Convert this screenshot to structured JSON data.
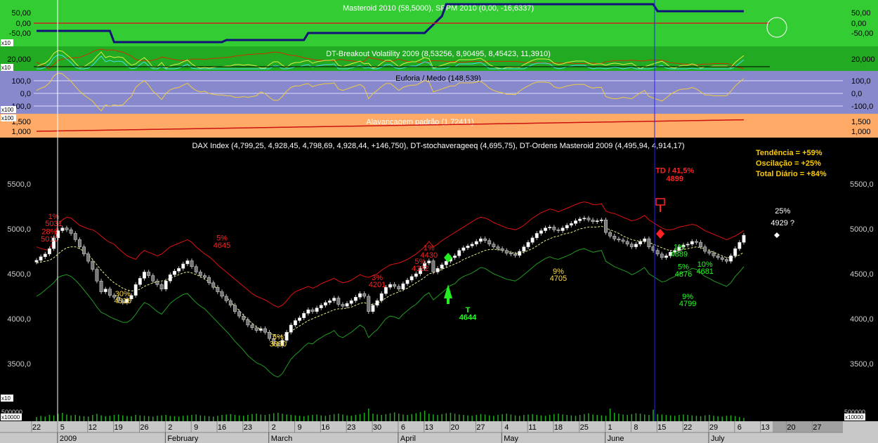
{
  "panels": {
    "masteroid": {
      "title": "Masteroid 2010 (58,5000), SPPM 2010 (0,00, -16,6337)",
      "ticks_left": [
        "50,00",
        "0,00",
        "-50,00"
      ],
      "ticks_right": [
        "50,00",
        "0,00",
        "-50,00"
      ],
      "scale_tag": "x10",
      "bg": "#33cc33"
    },
    "breakout": {
      "title": "DT-Breakout Volatility 2009 (8,53256, 8,90495, 8,45423, 11,3910)",
      "ticks_left": [
        "20,000"
      ],
      "ticks_right": [
        "20,000"
      ],
      "scale_tag": "x10",
      "bg": "#22aa22"
    },
    "euforia": {
      "title": "Euforia / Medo (148,539)",
      "ticks_left": [
        "100,0",
        "0,0",
        "-100,0"
      ],
      "ticks_right": [
        "100,0",
        "0,0",
        "-100,0"
      ],
      "scale_tag": "x100",
      "bg": "#8888cc"
    },
    "alavancagem": {
      "title": "Alavancagem padrão (1,72411)",
      "ticks_left": [
        "1,500",
        "1,000"
      ],
      "ticks_right": [
        "1,500",
        "1,000"
      ],
      "scale_tag": "x100",
      "bg": "#ffaa66"
    },
    "price": {
      "title": "DAX Index (4,799,25, 4,928,45, 4,798,69, 4,928,44, +146,750), DT-stochaverageeq (4,695,75), DT-Ordens Masteroid 2009 (4,495,94, 4,914,17)",
      "ticks_left": [
        "5500,0",
        "5000,0",
        "4500,0",
        "4000,0",
        "3500,0"
      ],
      "ticks_right": [
        "5500,0",
        "5000,0",
        "4500,0",
        "4000,0",
        "3500,0"
      ],
      "scale_tag": "x10",
      "volume_label": "500000",
      "volume_tag": "x10000"
    }
  },
  "summary": {
    "tendencia": "Tendência = +59%",
    "oscilacao": "Oscilação = +25%",
    "total": "Total Diário = +84%"
  },
  "annotations": [
    {
      "text": "1%",
      "color": "#ff2222",
      "i": 4,
      "p": 5110
    },
    {
      "text": "5031",
      "color": "#ff2222",
      "i": 4,
      "p": 5030
    },
    {
      "text": "28%",
      "color": "#ff2222",
      "i": 3,
      "p": 4940
    },
    {
      "text": "5010",
      "color": "#ff2222",
      "i": 3,
      "p": 4860
    },
    {
      "text": "5%",
      "color": "#ff2222",
      "i": 43,
      "p": 4870
    },
    {
      "text": "4645",
      "color": "#ff2222",
      "i": 43,
      "p": 4790
    },
    {
      "text": "30%",
      "color": "#ffdd44",
      "i": 20,
      "p": 4250
    },
    {
      "text": "4318",
      "color": "#ffdd44",
      "i": 20,
      "p": 4170
    },
    {
      "text": "5%",
      "color": "#ffdd44",
      "i": 56,
      "p": 3770
    },
    {
      "text": "3850",
      "color": "#ffdd44",
      "i": 56,
      "p": 3690
    },
    {
      "text": "3%",
      "color": "#ff2222",
      "i": 79,
      "p": 4430
    },
    {
      "text": "4201",
      "color": "#ff2222",
      "i": 79,
      "p": 4350
    },
    {
      "text": "5%",
      "color": "#ff2222",
      "i": 89,
      "p": 4610
    },
    {
      "text": "4382",
      "color": "#ff2222",
      "i": 89,
      "p": 4530
    },
    {
      "text": "1%",
      "color": "#ff2222",
      "i": 91,
      "p": 4760
    },
    {
      "text": "4430",
      "color": "#ff2222",
      "i": 91,
      "p": 4680
    },
    {
      "text": "T",
      "color": "#22ff22",
      "i": 100,
      "p": 4070
    },
    {
      "text": "4644",
      "color": "#22ff22",
      "i": 100,
      "p": 3990
    },
    {
      "text": "9%",
      "color": "#ffdd44",
      "i": 121,
      "p": 4500
    },
    {
      "text": "4705",
      "color": "#ffdd44",
      "i": 121,
      "p": 4420
    },
    {
      "text": "TD / 41,5%",
      "color": "#ff2222",
      "i": 148,
      "p": 5620
    },
    {
      "text": "4899",
      "color": "#ff2222",
      "i": 148,
      "p": 5530
    },
    {
      "text": "1%",
      "color": "#22ff22",
      "i": 149,
      "p": 4770
    },
    {
      "text": "4889",
      "color": "#22ff22",
      "i": 149,
      "p": 4690
    },
    {
      "text": "5%",
      "color": "#22ff22",
      "i": 150,
      "p": 4550
    },
    {
      "text": "4876",
      "color": "#22ff22",
      "i": 150,
      "p": 4470
    },
    {
      "text": "10%",
      "color": "#22ff22",
      "i": 155,
      "p": 4580
    },
    {
      "text": "4681",
      "color": "#22ff22",
      "i": 155,
      "p": 4500
    },
    {
      "text": "9%",
      "color": "#22ff22",
      "i": 151,
      "p": 4220
    },
    {
      "text": "4799",
      "color": "#22ff22",
      "i": 151,
      "p": 4140
    },
    {
      "text": "25%",
      "color": "#ffffff",
      "i": 173,
      "p": 5170
    },
    {
      "text": "4929 ?",
      "color": "#ffffff",
      "i": 173,
      "p": 5040
    }
  ],
  "xaxis": {
    "days": [
      {
        "label": "22",
        "i": 0
      },
      {
        "label": "5",
        "i": 6
      },
      {
        "label": "12",
        "i": 13
      },
      {
        "label": "19",
        "i": 19
      },
      {
        "label": "26",
        "i": 25
      },
      {
        "label": "2",
        "i": 31
      },
      {
        "label": "9",
        "i": 37
      },
      {
        "label": "16",
        "i": 43
      },
      {
        "label": "23",
        "i": 49
      },
      {
        "label": "2",
        "i": 55
      },
      {
        "label": "9",
        "i": 61
      },
      {
        "label": "16",
        "i": 67
      },
      {
        "label": "23",
        "i": 73
      },
      {
        "label": "30",
        "i": 79
      },
      {
        "label": "6",
        "i": 85
      },
      {
        "label": "13",
        "i": 91
      },
      {
        "label": "20",
        "i": 97
      },
      {
        "label": "27",
        "i": 103
      },
      {
        "label": "4",
        "i": 109
      },
      {
        "label": "11",
        "i": 115
      },
      {
        "label": "18",
        "i": 121
      },
      {
        "label": "25",
        "i": 127
      },
      {
        "label": "1",
        "i": 133
      },
      {
        "label": "8",
        "i": 139
      },
      {
        "label": "15",
        "i": 145
      },
      {
        "label": "22",
        "i": 151
      },
      {
        "label": "29",
        "i": 157
      },
      {
        "label": "6",
        "i": 163
      },
      {
        "label": "13",
        "i": 169
      },
      {
        "label": "20",
        "i": 175
      },
      {
        "label": "27",
        "i": 181
      }
    ],
    "months": [
      {
        "label": "2009",
        "i": 6
      },
      {
        "label": "February",
        "i": 31
      },
      {
        "label": "March",
        "i": 55
      },
      {
        "label": "April",
        "i": 85
      },
      {
        "label": "May",
        "i": 109
      },
      {
        "label": "June",
        "i": 133
      },
      {
        "label": "July",
        "i": 157
      }
    ]
  },
  "chart_data": {
    "type": "candlestick",
    "title": "DAX Index (4,799,25, 4,928,45, 4,798,69, 4,928,44, +146,750), DT-stochaverageeq (4,695,75), DT-Ordens Masteroid 2009 (4,495,94, 4,914,17)",
    "ylim": [
      3200,
      5900
    ],
    "y_ticks": [
      3500,
      4000,
      4500,
      5000,
      5500
    ],
    "close": [
      4650,
      4690,
      4720,
      4780,
      4900,
      4980,
      5010,
      4990,
      4950,
      4880,
      4800,
      4720,
      4640,
      4550,
      4420,
      4300,
      4330,
      4260,
      4240,
      4200,
      4180,
      4220,
      4260,
      4380,
      4450,
      4520,
      4480,
      4420,
      4380,
      4330,
      4420,
      4490,
      4530,
      4560,
      4610,
      4645,
      4580,
      4520,
      4480,
      4460,
      4400,
      4350,
      4300,
      4250,
      4200,
      4150,
      4080,
      4030,
      3990,
      3930,
      3900,
      3870,
      3890,
      3850,
      3780,
      3720,
      3700,
      3760,
      3850,
      3930,
      3980,
      4010,
      4060,
      4100,
      4080,
      4120,
      4150,
      4180,
      4200,
      4230,
      4160,
      4140,
      4170,
      4201,
      4240,
      4280,
      4250,
      4080,
      4150,
      4201,
      4280,
      4350,
      4382,
      4360,
      4330,
      4390,
      4430,
      4470,
      4500,
      4560,
      4620,
      4644,
      4520,
      4560,
      4600,
      4640,
      4680,
      4700,
      4760,
      4790,
      4810,
      4830,
      4860,
      4890,
      4870,
      4830,
      4800,
      4780,
      4760,
      4730,
      4720,
      4705,
      4750,
      4800,
      4850,
      4900,
      4950,
      4980,
      5010,
      5020,
      4990,
      4980,
      5010,
      5040,
      5060,
      5090,
      5110,
      5120,
      5100,
      5080,
      5090,
      5100,
      4960,
      4920,
      4889,
      4876,
      4860,
      4830,
      4800,
      4830,
      4860,
      4890,
      4800,
      4760,
      4720,
      4681,
      4700,
      4740,
      4760,
      4799,
      4820,
      4830,
      4860,
      4850,
      4800,
      4750,
      4730,
      4700,
      4680,
      4660,
      4640,
      4700,
      4780,
      4850,
      4929
    ],
    "ma": [
      4620,
      4630,
      4640,
      4650,
      4680,
      4720,
      4760,
      4790,
      4800,
      4800,
      4780,
      4750,
      4710,
      4660,
      4600,
      4540,
      4490,
      4440,
      4400,
      4370,
      4340,
      4320,
      4310,
      4310,
      4330,
      4360,
      4380,
      4400,
      4410,
      4420,
      4430,
      4450,
      4470,
      4490,
      4510,
      4520,
      4510,
      4490,
      4470,
      4440,
      4410,
      4370,
      4330,
      4280,
      4240,
      4190,
      4140,
      4090,
      4040,
      3990,
      3950,
      3910,
      3880,
      3860,
      3840,
      3820,
      3800,
      3810,
      3830,
      3860,
      3890,
      3920,
      3950,
      3980,
      4000,
      4020,
      4040,
      4060,
      4080,
      4100,
      4110,
      4110,
      4120,
      4130,
      4150,
      4170,
      4180,
      4160,
      4160,
      4170,
      4200,
      4230,
      4260,
      4280,
      4300,
      4320,
      4340,
      4370,
      4400,
      4430,
      4460,
      4500,
      4510,
      4530,
      4550,
      4570,
      4590,
      4610,
      4630,
      4660,
      4680,
      4700,
      4720,
      4740,
      4760,
      4770,
      4770,
      4770,
      4760,
      4750,
      4740,
      4730,
      4730,
      4740,
      4760,
      4780,
      4810,
      4840,
      4870,
      4890,
      4910,
      4920,
      4940,
      4950,
      4960,
      4980,
      5000,
      5010,
      5020,
      5020,
      5020,
      5030,
      5010,
      4990,
      4970,
      4950,
      4920,
      4900,
      4880,
      4870,
      4860,
      4860,
      4850,
      4830,
      4810,
      4790,
      4770,
      4760,
      4750,
      4760,
      4770,
      4780,
      4790,
      4800,
      4790,
      4780,
      4760,
      4740,
      4720,
      4700,
      4680,
      4680,
      4690,
      4710,
      4740
    ],
    "upper": [
      4800,
      4780,
      4770,
      4760,
      4900,
      5050,
      5100,
      5130,
      5120,
      5080,
      5040,
      5020,
      5000,
      4990,
      4960,
      4920,
      4880,
      4850,
      4830,
      4780,
      4740,
      4700,
      4680,
      4660,
      4720,
      4760,
      4740,
      4720,
      4700,
      4720,
      4760,
      4800,
      4820,
      4840,
      4860,
      4880,
      4850,
      4800,
      4760,
      4720,
      4690,
      4650,
      4600,
      4560,
      4520,
      4480,
      4440,
      4400,
      4360,
      4320,
      4280,
      4250,
      4230,
      4210,
      4180,
      4150,
      4130,
      4150,
      4200,
      4260,
      4300,
      4320,
      4340,
      4360,
      4340,
      4360,
      4390,
      4410,
      4430,
      4450,
      4420,
      4400,
      4410,
      4430,
      4460,
      4490,
      4470,
      4460,
      4480,
      4500,
      4540,
      4570,
      4600,
      4610,
      4620,
      4640,
      4660,
      4690,
      4720,
      4760,
      4800,
      4860,
      4800,
      4830,
      4870,
      4900,
      4930,
      4960,
      4990,
      5020,
      5050,
      5080,
      5110,
      5130,
      5120,
      5100,
      5070,
      5050,
      5030,
      5010,
      5000,
      4990,
      5010,
      5040,
      5080,
      5120,
      5150,
      5180,
      5200,
      5220,
      5210,
      5190,
      5210,
      5230,
      5250,
      5270,
      5290,
      5300,
      5290,
      5270,
      5270,
      5280,
      5200,
      5180,
      5170,
      5150,
      5130,
      5110,
      5090,
      5100,
      5120,
      5150,
      5100,
      5070,
      5040,
      5010,
      4990,
      4990,
      5000,
      5020,
      5030,
      5040,
      5050,
      5040,
      5010,
      4980,
      4960,
      4940,
      4920,
      4900,
      4880,
      4900,
      4920,
      4950,
      4980
    ],
    "lower": [
      4250,
      4280,
      4320,
      4360,
      4400,
      4460,
      4480,
      4490,
      4470,
      4430,
      4380,
      4320,
      4260,
      4200,
      4130,
      4070,
      4050,
      4020,
      4000,
      3980,
      3960,
      3960,
      3990,
      4050,
      4120,
      4180,
      4160,
      4120,
      4080,
      4050,
      4110,
      4170,
      4210,
      4240,
      4270,
      4280,
      4230,
      4180,
      4140,
      4110,
      4060,
      4010,
      3960,
      3910,
      3860,
      3810,
      3750,
      3700,
      3650,
      3590,
      3550,
      3510,
      3490,
      3460,
      3410,
      3370,
      3350,
      3390,
      3470,
      3550,
      3600,
      3640,
      3690,
      3730,
      3720,
      3760,
      3790,
      3820,
      3840,
      3870,
      3810,
      3790,
      3820,
      3850,
      3890,
      3930,
      3900,
      3790,
      3840,
      3880,
      3940,
      4000,
      4030,
      4020,
      4000,
      4050,
      4090,
      4130,
      4160,
      4210,
      4260,
      4290,
      4210,
      4250,
      4290,
      4330,
      4370,
      4390,
      4440,
      4470,
      4490,
      4510,
      4540,
      4570,
      4560,
      4530,
      4500,
      4480,
      4460,
      4440,
      4430,
      4420,
      4450,
      4490,
      4530,
      4570,
      4610,
      4640,
      4670,
      4690,
      4670,
      4660,
      4680,
      4700,
      4720,
      4750,
      4770,
      4780,
      4760,
      4740,
      4750,
      4760,
      4640,
      4610,
      4580,
      4560,
      4540,
      4520,
      4490,
      4510,
      4540,
      4570,
      4500,
      4470,
      4440,
      4410,
      4420,
      4450,
      4470,
      4500,
      4520,
      4530,
      4560,
      4550,
      4510,
      4470,
      4450,
      4420,
      4400,
      4380,
      4360,
      4400,
      4470,
      4520,
      4580
    ],
    "volume": [
      20,
      25,
      22,
      30,
      28,
      35,
      40,
      32,
      28,
      30,
      26,
      24,
      22,
      30,
      35,
      28,
      24,
      26,
      30,
      32,
      28,
      25,
      24,
      30,
      28,
      26,
      24,
      22,
      26,
      28,
      30,
      25,
      24,
      22,
      26,
      28,
      30,
      32,
      28,
      26,
      24,
      22,
      26,
      30,
      32,
      34,
      30,
      28,
      26,
      30,
      34,
      36,
      32,
      30,
      34,
      38,
      40,
      36,
      32,
      30,
      28,
      26,
      24,
      28,
      30,
      32,
      28,
      26,
      30,
      34,
      36,
      32,
      28,
      26,
      30,
      34,
      40,
      60,
      36,
      32,
      30,
      34,
      38,
      42,
      36,
      32,
      30,
      34,
      38,
      44,
      50,
      36,
      32,
      30,
      34,
      38,
      40,
      36,
      32,
      30,
      28,
      26,
      30,
      34,
      32,
      28,
      26,
      30,
      34,
      36,
      32,
      28,
      26,
      30,
      32,
      34,
      30,
      28,
      26,
      30,
      34,
      36,
      32,
      30,
      28,
      26,
      30,
      34,
      38,
      32,
      30,
      28,
      26,
      60,
      40,
      36,
      32,
      30,
      34,
      38,
      36,
      32,
      30,
      55,
      34,
      32,
      30,
      28,
      26,
      30,
      32,
      30,
      28,
      26,
      24,
      28,
      30,
      26,
      24,
      22,
      26,
      28,
      24,
      20,
      16
    ]
  }
}
